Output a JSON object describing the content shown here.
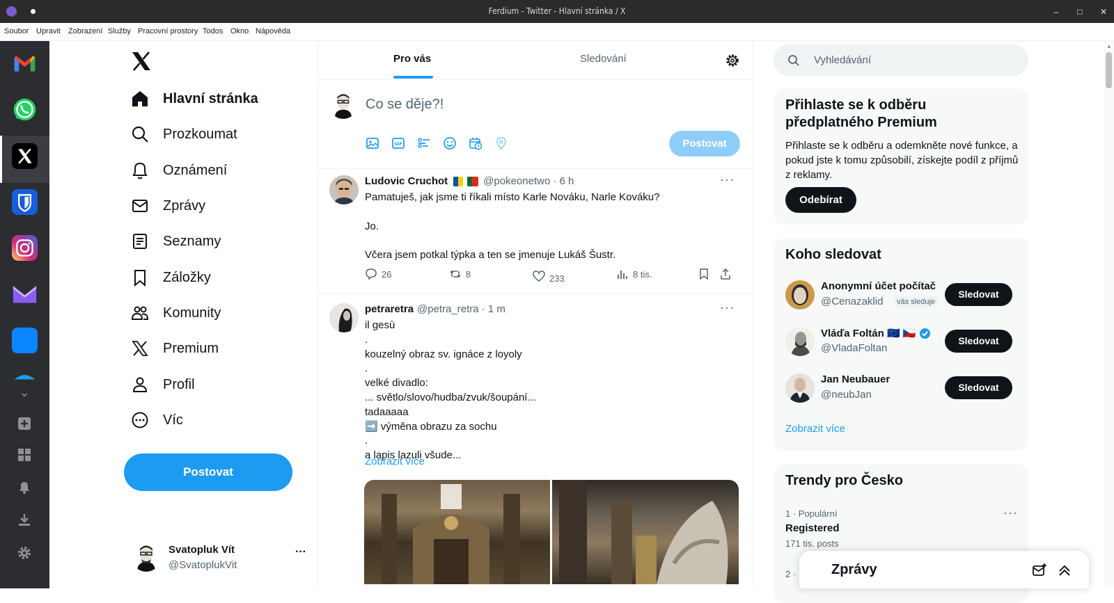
{
  "window": {
    "title": "Ferdium - Twitter - Hlavní stránka / X"
  },
  "menubar": [
    "Soubor",
    "Upravit",
    "Zobrazení",
    "Služby",
    "Pracovní prostory",
    "Todos",
    "Okno",
    "Nápověda"
  ],
  "dock": {
    "services": [
      "Gmail",
      "WhatsApp",
      "X",
      "Bitwarden",
      "Instagram",
      "Proton Mail",
      "App",
      "App"
    ],
    "active": "X",
    "tools": [
      "chevron-down-icon",
      "add-service-icon",
      "workspaces-icon",
      "notifications-icon",
      "downloads-icon",
      "settings-icon"
    ]
  },
  "nav": {
    "items": [
      {
        "label": "Hlavní stránka",
        "icon": "home-icon"
      },
      {
        "label": "Prozkoumat",
        "icon": "search-icon"
      },
      {
        "label": "Oznámení",
        "icon": "bell-icon"
      },
      {
        "label": "Zprávy",
        "icon": "mail-icon"
      },
      {
        "label": "Seznamy",
        "icon": "list-icon"
      },
      {
        "label": "Záložky",
        "icon": "bookmark-icon"
      },
      {
        "label": "Komunity",
        "icon": "community-icon"
      },
      {
        "label": "Premium",
        "icon": "x-logo-icon"
      },
      {
        "label": "Profil",
        "icon": "person-icon"
      },
      {
        "label": "Víc",
        "icon": "more-icon"
      }
    ],
    "post_button": "Postovat",
    "account": {
      "name": "Svatopluk Vít",
      "handle": "@SvatoplukVit"
    }
  },
  "feed": {
    "tabs": [
      "Pro vás",
      "Sledování"
    ],
    "active_tab": "Pro vás",
    "composer": {
      "placeholder": "Co se děje?!",
      "post_button": "Postovat"
    },
    "tweets": [
      {
        "name": "Ludovic Cruchot",
        "handle": "@pokeonetwo",
        "time": "· 6 h",
        "text": "Pamatuješ, jak jsme ti říkali místo Karle Nováku, Narle Kováku?\n\nJo.\n\nVčera jsem potkal týpka a ten se jmenuje Lukáš Šustr.",
        "replies": "26",
        "reposts": "8",
        "likes": "233",
        "views": "8 tis."
      },
      {
        "name": "petraretra",
        "handle": "@petra_retra",
        "time": "· 1 m",
        "text": "il gesù\n.\nkouzelný obraz sv. ignáce z loyoly\n.\nvelké divadlo:\n... světlo/slovo/hudba/zvuk/šoupání...\ntadaaaaa\n➡️ výměna obrazu za sochu\n.\na lapis lazuli všude...",
        "show_more": "Zobrazit více"
      }
    ]
  },
  "sidebar": {
    "search_placeholder": "Vyhledávání",
    "premium": {
      "title": "Přihlaste se k odběru předplatného Premium",
      "text": "Přihlaste se k odběru a odemkněte nové funkce, a pokud jste k tomu způsobilí, získejte podíl z příjmů z reklamy.",
      "button": "Odebírat"
    },
    "who_to_follow": {
      "title": "Koho sledovat",
      "users": [
        {
          "name": "Anonymní účet počítač",
          "handle": "@Cenazaklid",
          "badge": "vás sleduje",
          "button": "Sledovat"
        },
        {
          "name": "Vláďa Foltán 🇪🇺 🇨🇿",
          "handle": "@VladaFoltan",
          "button": "Sledovat"
        },
        {
          "name": "Jan Neubauer",
          "handle": "@neubJan",
          "button": "Sledovat"
        }
      ],
      "show_more": "Zobrazit více"
    },
    "trends": {
      "title": "Trendy pro Česko",
      "items": [
        {
          "rank": "1 · Populární",
          "topic": "Registered",
          "posts": "171 tis. posts"
        },
        {
          "rank": "2 ·"
        }
      ]
    },
    "messages": {
      "title": "Zprávy"
    }
  },
  "colors": {
    "accent": "#1d9bf0",
    "dock_bg": "#2c2d30",
    "titlebar_bg": "#2b2b2b"
  }
}
